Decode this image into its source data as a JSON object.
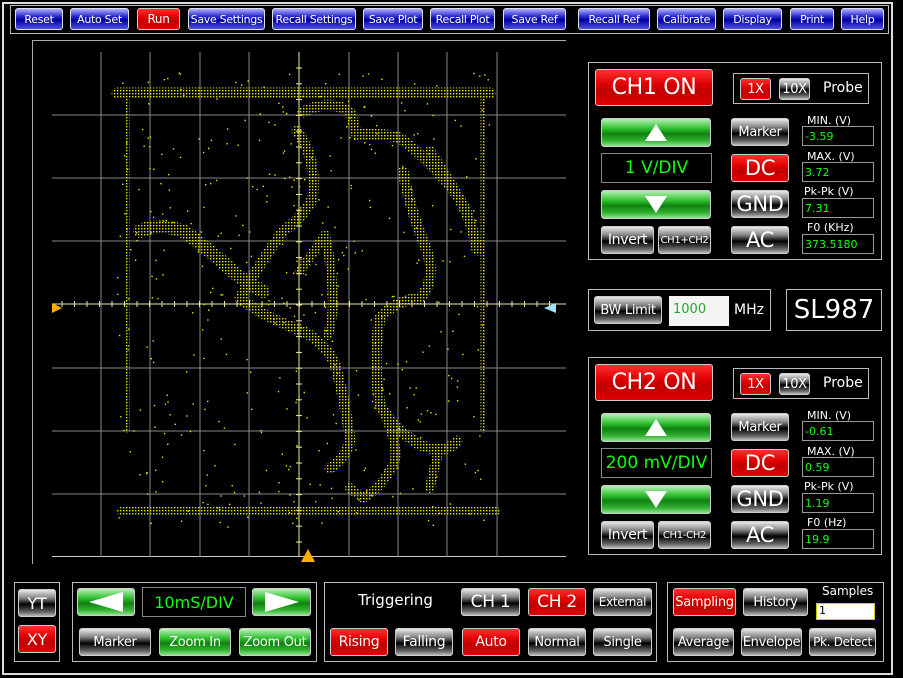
{
  "toolbar": {
    "buttons": [
      {
        "label": "Reset",
        "active": false
      },
      {
        "label": "Auto Set",
        "active": false
      },
      {
        "label": "Run",
        "active": true
      },
      {
        "label": "Save Settings",
        "active": false
      },
      {
        "label": "Recall Settings",
        "active": false
      },
      {
        "label": "Save Plot",
        "active": false
      },
      {
        "label": "Recall Plot",
        "active": false
      },
      {
        "label": "Save Ref",
        "active": false
      },
      {
        "label": "Recall Ref",
        "active": false
      },
      {
        "label": "Calibrate",
        "active": false
      },
      {
        "label": "Display",
        "active": false
      },
      {
        "label": "Print",
        "active": false
      },
      {
        "label": "Help",
        "active": false
      }
    ]
  },
  "ch1": {
    "on_label": "CH1 ON",
    "probe_1x": "1X",
    "probe_10x": "10X",
    "probe_label": "Probe",
    "probe_selected": "1X",
    "volts_div": "1 V/DIV",
    "invert": "Invert",
    "math": "CH1+CH2",
    "marker": "Marker",
    "dc": "DC",
    "gnd": "GND",
    "ac": "AC",
    "coupling": "DC",
    "min_label": "MIN. (V)",
    "min": "-3.59",
    "max_label": "MAX. (V)",
    "max": "3.72",
    "pkpk_label": "Pk-Pk (V)",
    "pkpk": "7.31",
    "f0_label": "F0 (KHz)",
    "f0": "373.5180"
  },
  "ch2": {
    "on_label": "CH2 ON",
    "probe_1x": "1X",
    "probe_10x": "10X",
    "probe_label": "Probe",
    "probe_selected": "1X",
    "volts_div": "200 mV/DIV",
    "invert": "Invert",
    "math": "CH1-CH2",
    "marker": "Marker",
    "dc": "DC",
    "gnd": "GND",
    "ac": "AC",
    "coupling": "DC",
    "min_label": "MIN. (V)",
    "min": "-0.61",
    "max_label": "MAX. (V)",
    "max": "0.59",
    "pkpk_label": "Pk-Pk (V)",
    "pkpk": "1.19",
    "f0_label": "F0 (Hz)",
    "f0": "19.9"
  },
  "bandwidth": {
    "button": "BW Limit",
    "value": "1000",
    "unit": "MHz"
  },
  "model": "SL987",
  "mode": {
    "yt": "YT",
    "xy": "XY",
    "selected": "XY"
  },
  "timebase": {
    "value": "10mS/DIV",
    "marker": "Marker",
    "zoom_in": "Zoom In",
    "zoom_out": "Zoom Out"
  },
  "trigger": {
    "title": "Triggering",
    "ch1": "CH 1",
    "ch2": "CH 2",
    "external": "External",
    "source": "CH 2",
    "rising": "Rising",
    "falling": "Falling",
    "slope": "Rising",
    "auto": "Auto",
    "normal": "Normal",
    "single": "Single",
    "mode": "Auto"
  },
  "acquisition": {
    "sampling": "Sampling",
    "history": "History",
    "samples_label": "Samples",
    "samples": "1",
    "average": "Average",
    "envelope": "Envelope",
    "pk_detect": "Pk. Detect",
    "selected": "Sampling"
  },
  "colors": {
    "trace": "#ffff00",
    "active": "#e00000",
    "lcd_text": "#11ff11",
    "ch1_marker": "#ffb000",
    "ch2_marker": "#a0e0ff"
  }
}
